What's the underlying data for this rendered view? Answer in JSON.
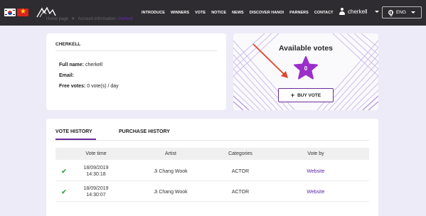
{
  "header": {
    "nav": [
      "INTRODUCE",
      "WINNERS",
      "VOTE",
      "NOTICE",
      "NEWS",
      "DISCOVER HANOI",
      "PARNERS",
      "CONTACT"
    ],
    "user": "cherkell",
    "language": "ENG"
  },
  "breadcrumb": {
    "home": "Home page",
    "section": "Account information",
    "current": "cherkell"
  },
  "account": {
    "title": "CHERKELL",
    "full_name_label": "Full name:",
    "full_name": " cherkell",
    "email_label": "Email:",
    "email": "",
    "free_votes_label": "Free votes:",
    "free_votes": " 0 vote(s) / day"
  },
  "votes": {
    "title": "Available votes",
    "count": "0",
    "buy_label": "BUY VOTE"
  },
  "history": {
    "tabs": [
      "VOTE HISTORY",
      "PURCHASE HISTORY"
    ],
    "columns": [
      "Vote time",
      "Artist",
      "Categories",
      "Vote by"
    ],
    "rows": [
      {
        "date": "18/09/2019",
        "time": "14:30:18",
        "artist": "Ji Chang Wook",
        "category": "ACTOR",
        "by": "Website"
      },
      {
        "date": "18/09/2019",
        "time": "14:30:07",
        "artist": "Ji Chang Wook",
        "category": "ACTOR",
        "by": "Website"
      }
    ]
  },
  "colors": {
    "header_bg": "#2e2c30",
    "accent": "#6a2c9a",
    "star": "#9b2fc9",
    "check": "#3aa33f",
    "arrow": "#e0442b",
    "page_bg": "#ecebf7"
  }
}
